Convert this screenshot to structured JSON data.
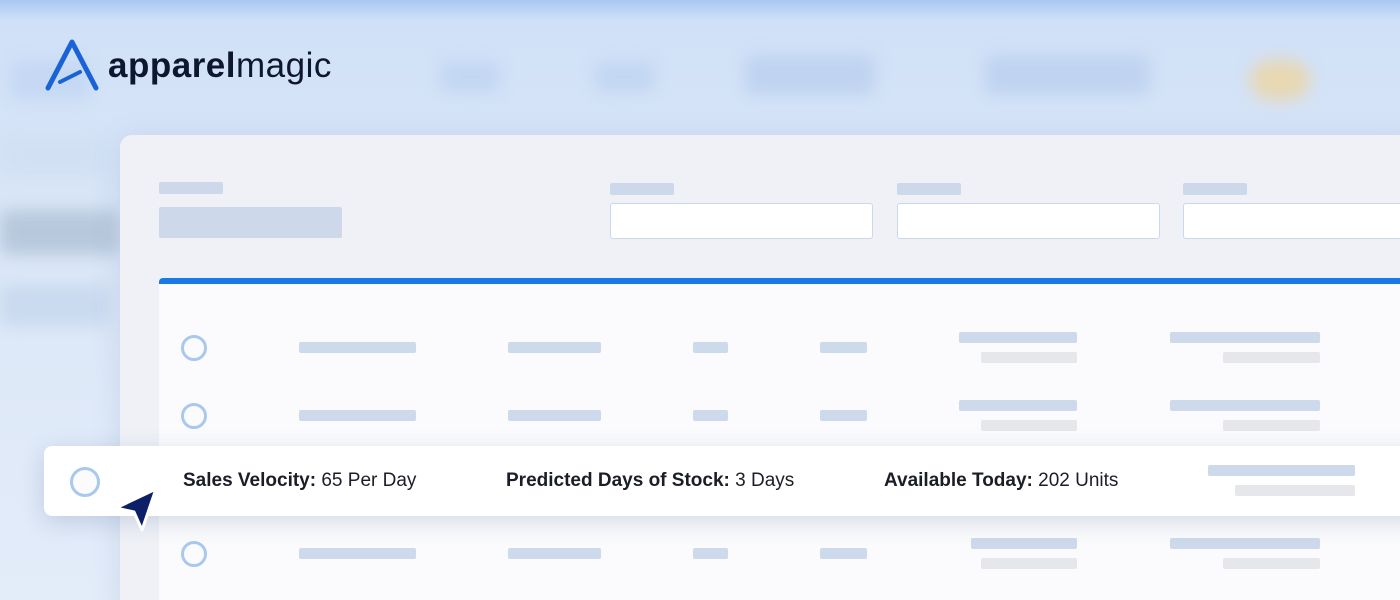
{
  "brand": {
    "name_bold": "apparel",
    "name_light": "magic",
    "colors": {
      "logo_mark": "#1a63d6",
      "accent": "#1a7ae5",
      "text": "#0e1630"
    }
  },
  "highlight_row": {
    "metrics": [
      {
        "label": "Sales Velocity:",
        "value": "65 Per Day"
      },
      {
        "label": "Predicted Days of Stock:",
        "value": "3 Days"
      },
      {
        "label": "Available Today:",
        "value": "202 Units"
      }
    ]
  },
  "icons": {
    "logo_mark": "apparelmagic-logo-icon",
    "cursor": "arrow-cursor-icon",
    "row_select": "radio-button"
  }
}
